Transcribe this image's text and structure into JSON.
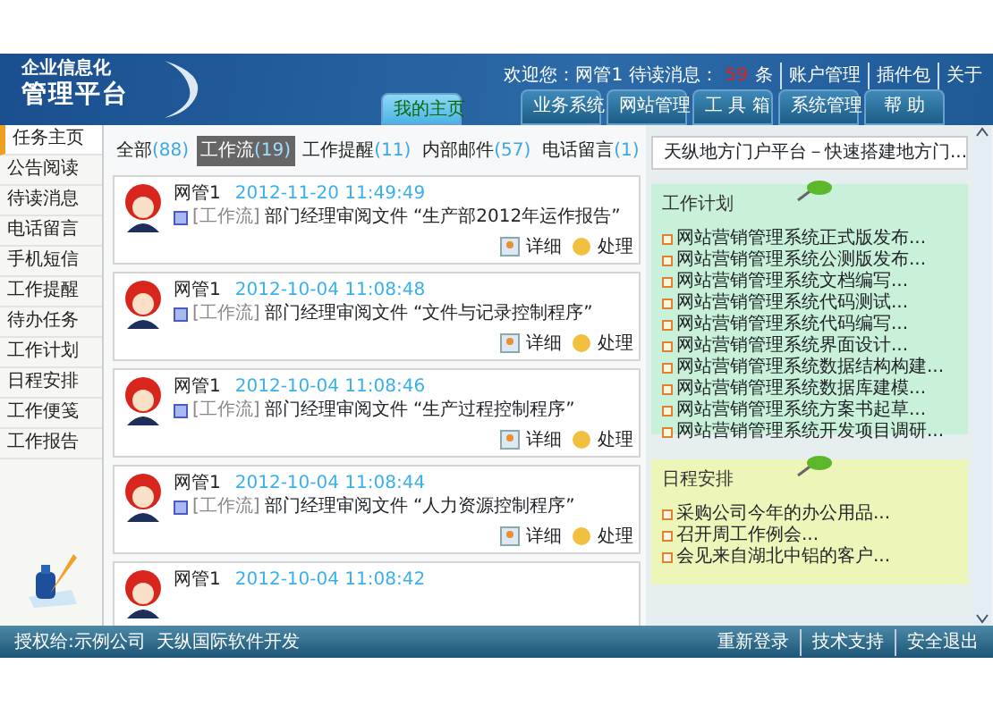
{
  "header": {
    "logo_line_1": "企业信息化",
    "logo_line_2": "管理平台",
    "welcome": "欢迎您：网管1 待读消息：",
    "unread_count": "59",
    "unread_unit": "条",
    "links": [
      "账户管理",
      "插件包",
      "关于"
    ],
    "nav": [
      {
        "label": "我的主页",
        "selected": true
      },
      {
        "label": "业务系统",
        "selected": false
      },
      {
        "label": "网站管理",
        "selected": false
      },
      {
        "label": "工 具 箱",
        "selected": false
      },
      {
        "label": "系统管理",
        "selected": false
      },
      {
        "label": "帮 助",
        "selected": false
      }
    ]
  },
  "sidebar": {
    "items": [
      {
        "label": "任务主页",
        "selected": true
      },
      {
        "label": "公告阅读",
        "selected": false
      },
      {
        "label": "待读消息",
        "selected": false
      },
      {
        "label": "电话留言",
        "selected": false
      },
      {
        "label": "手机短信",
        "selected": false
      },
      {
        "label": "工作提醒",
        "selected": false
      },
      {
        "label": "待办任务",
        "selected": false
      },
      {
        "label": "工作计划",
        "selected": false
      },
      {
        "label": "日程安排",
        "selected": false
      },
      {
        "label": "工作便笺",
        "selected": false
      },
      {
        "label": "工作报告",
        "selected": false
      }
    ]
  },
  "filters": [
    {
      "label": "全部",
      "count": "(88)",
      "selected": false
    },
    {
      "label": "工作流",
      "count": "(19)",
      "selected": true
    },
    {
      "label": "工作提醒",
      "count": "(11)",
      "selected": false
    },
    {
      "label": "内部邮件",
      "count": "(57)",
      "selected": false
    },
    {
      "label": "电话留言",
      "count": "(1)",
      "selected": false
    }
  ],
  "messages": [
    {
      "user": "网管1",
      "time": "2012-11-20 11:49:49",
      "tag": "[工作流]",
      "text": "部门经理审阅文件 “生产部2012年运作报告”",
      "actions": [
        "详细",
        "处理"
      ]
    },
    {
      "user": "网管1",
      "time": "2012-10-04 11:08:48",
      "tag": "[工作流]",
      "text": "部门经理审阅文件 “文件与记录控制程序”",
      "actions": [
        "详细",
        "处理"
      ]
    },
    {
      "user": "网管1",
      "time": "2012-10-04 11:08:46",
      "tag": "[工作流]",
      "text": "部门经理审阅文件 “生产过程控制程序”",
      "actions": [
        "详细",
        "处理"
      ]
    },
    {
      "user": "网管1",
      "time": "2012-10-04 11:08:44",
      "tag": "[工作流]",
      "text": "部门经理审阅文件 “人力资源控制程序”",
      "actions": [
        "详细",
        "处理"
      ]
    },
    {
      "user": "网管1",
      "time": "2012-10-04 11:08:42"
    }
  ],
  "portal_link": "天纵地方门户平台－快速搭建地方门...",
  "work_plan": {
    "title": "工作计划",
    "items": [
      "网站营销管理系统正式版发布...",
      "网站营销管理系统公测版发布...",
      "网站营销管理系统文档编写...",
      "网站营销管理系统代码测试...",
      "网站营销管理系统代码编写...",
      "网站营销管理系统界面设计...",
      "网站营销管理系统数据结构构建...",
      "网站营销管理系统数据库建模...",
      "网站营销管理系统方案书起草...",
      "网站营销管理系统开发项目调研..."
    ]
  },
  "schedule": {
    "title": "日程安排",
    "items": [
      "采购公司今年的办公用品...",
      "召开周工作例会...",
      "会见来自湖北中铝的客户..."
    ]
  },
  "footer": {
    "licensee": "授权给:示例公司",
    "developer": "天纵国际软件开发",
    "links": [
      "重新登录",
      "技术支持",
      "安全退出"
    ]
  }
}
